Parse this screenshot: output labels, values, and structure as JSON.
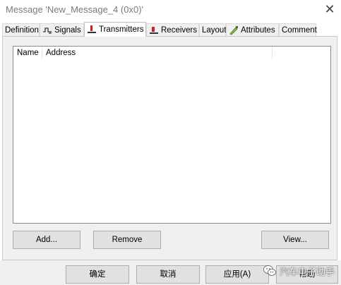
{
  "window": {
    "title": "Message 'New_Message_4 (0x0)'",
    "close_symbol": "✕"
  },
  "tabs": [
    {
      "label": "Definition",
      "icon": "",
      "active": false
    },
    {
      "label": "Signals",
      "icon": "signals-icon",
      "active": false
    },
    {
      "label": "Transmitters",
      "icon": "transmitter-icon",
      "active": true
    },
    {
      "label": "Receivers",
      "icon": "receiver-icon",
      "active": false
    },
    {
      "label": "Layout",
      "icon": "",
      "active": false
    },
    {
      "label": "Attributes",
      "icon": "attributes-icon",
      "active": false
    },
    {
      "label": "Comment",
      "icon": "",
      "active": false
    }
  ],
  "list": {
    "columns": [
      "Name",
      "Address"
    ]
  },
  "panel_buttons": {
    "add": "Add...",
    "remove": "Remove",
    "view": "View..."
  },
  "dialog_buttons": {
    "ok": "确定",
    "cancel": "取消",
    "apply": "应用(A)",
    "help": "帮助"
  },
  "watermark": {
    "text": "汽车电子助手",
    "icon": "wechat-icon"
  },
  "colors": {
    "title_text": "#7a7a7a",
    "panel_bg": "#f0f0f0",
    "button_bg": "#e1e1e1",
    "icon_red": "#cc1f1f"
  }
}
